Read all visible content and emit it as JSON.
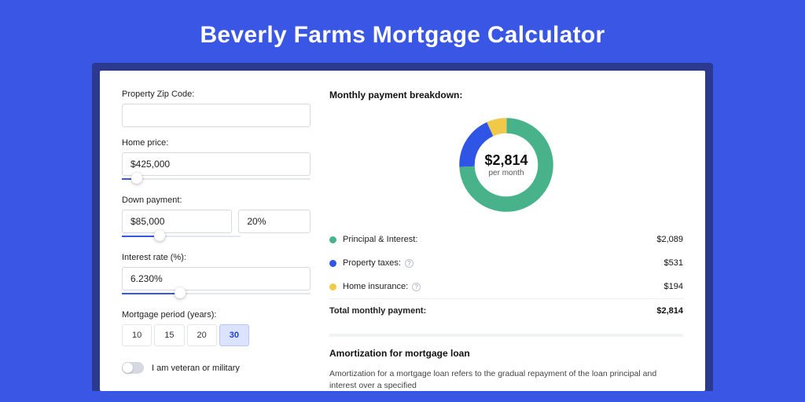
{
  "title": "Beverly Farms Mortgage Calculator",
  "form": {
    "zip_label": "Property Zip Code:",
    "zip_value": "",
    "price_label": "Home price:",
    "price_value": "$425,000",
    "price_slider_pct": 8,
    "down_label": "Down payment:",
    "down_value": "$85,000",
    "down_pct": "20%",
    "down_slider_pct": 20,
    "rate_label": "Interest rate (%):",
    "rate_value": "6.230%",
    "rate_slider_pct": 31,
    "period_label": "Mortgage period (years):",
    "periods": [
      "10",
      "15",
      "20",
      "30"
    ],
    "period_active_index": 3,
    "veteran_label": "I am veteran or military"
  },
  "breakdown": {
    "title": "Monthly payment breakdown:",
    "center_amount": "$2,814",
    "center_sub": "per month",
    "rows": [
      {
        "label": "Principal & Interest:",
        "value": "$2,089",
        "color": "#48b38a",
        "info": false
      },
      {
        "label": "Property taxes:",
        "value": "$531",
        "color": "#2e55e6",
        "info": true
      },
      {
        "label": "Home insurance:",
        "value": "$194",
        "color": "#f0c94a",
        "info": true
      }
    ],
    "total_label": "Total monthly payment:",
    "total_value": "$2,814"
  },
  "amort": {
    "title": "Amortization for mortgage loan",
    "text": "Amortization for a mortgage loan refers to the gradual repayment of the loan principal and interest over a specified"
  },
  "chart_data": {
    "type": "pie",
    "title": "Monthly payment breakdown",
    "series": [
      {
        "name": "Principal & Interest",
        "value": 2089,
        "color": "#48b38a"
      },
      {
        "name": "Property taxes",
        "value": 531,
        "color": "#2e55e6"
      },
      {
        "name": "Home insurance",
        "value": 194,
        "color": "#f0c94a"
      }
    ],
    "total": 2814,
    "hole": 0.62
  }
}
